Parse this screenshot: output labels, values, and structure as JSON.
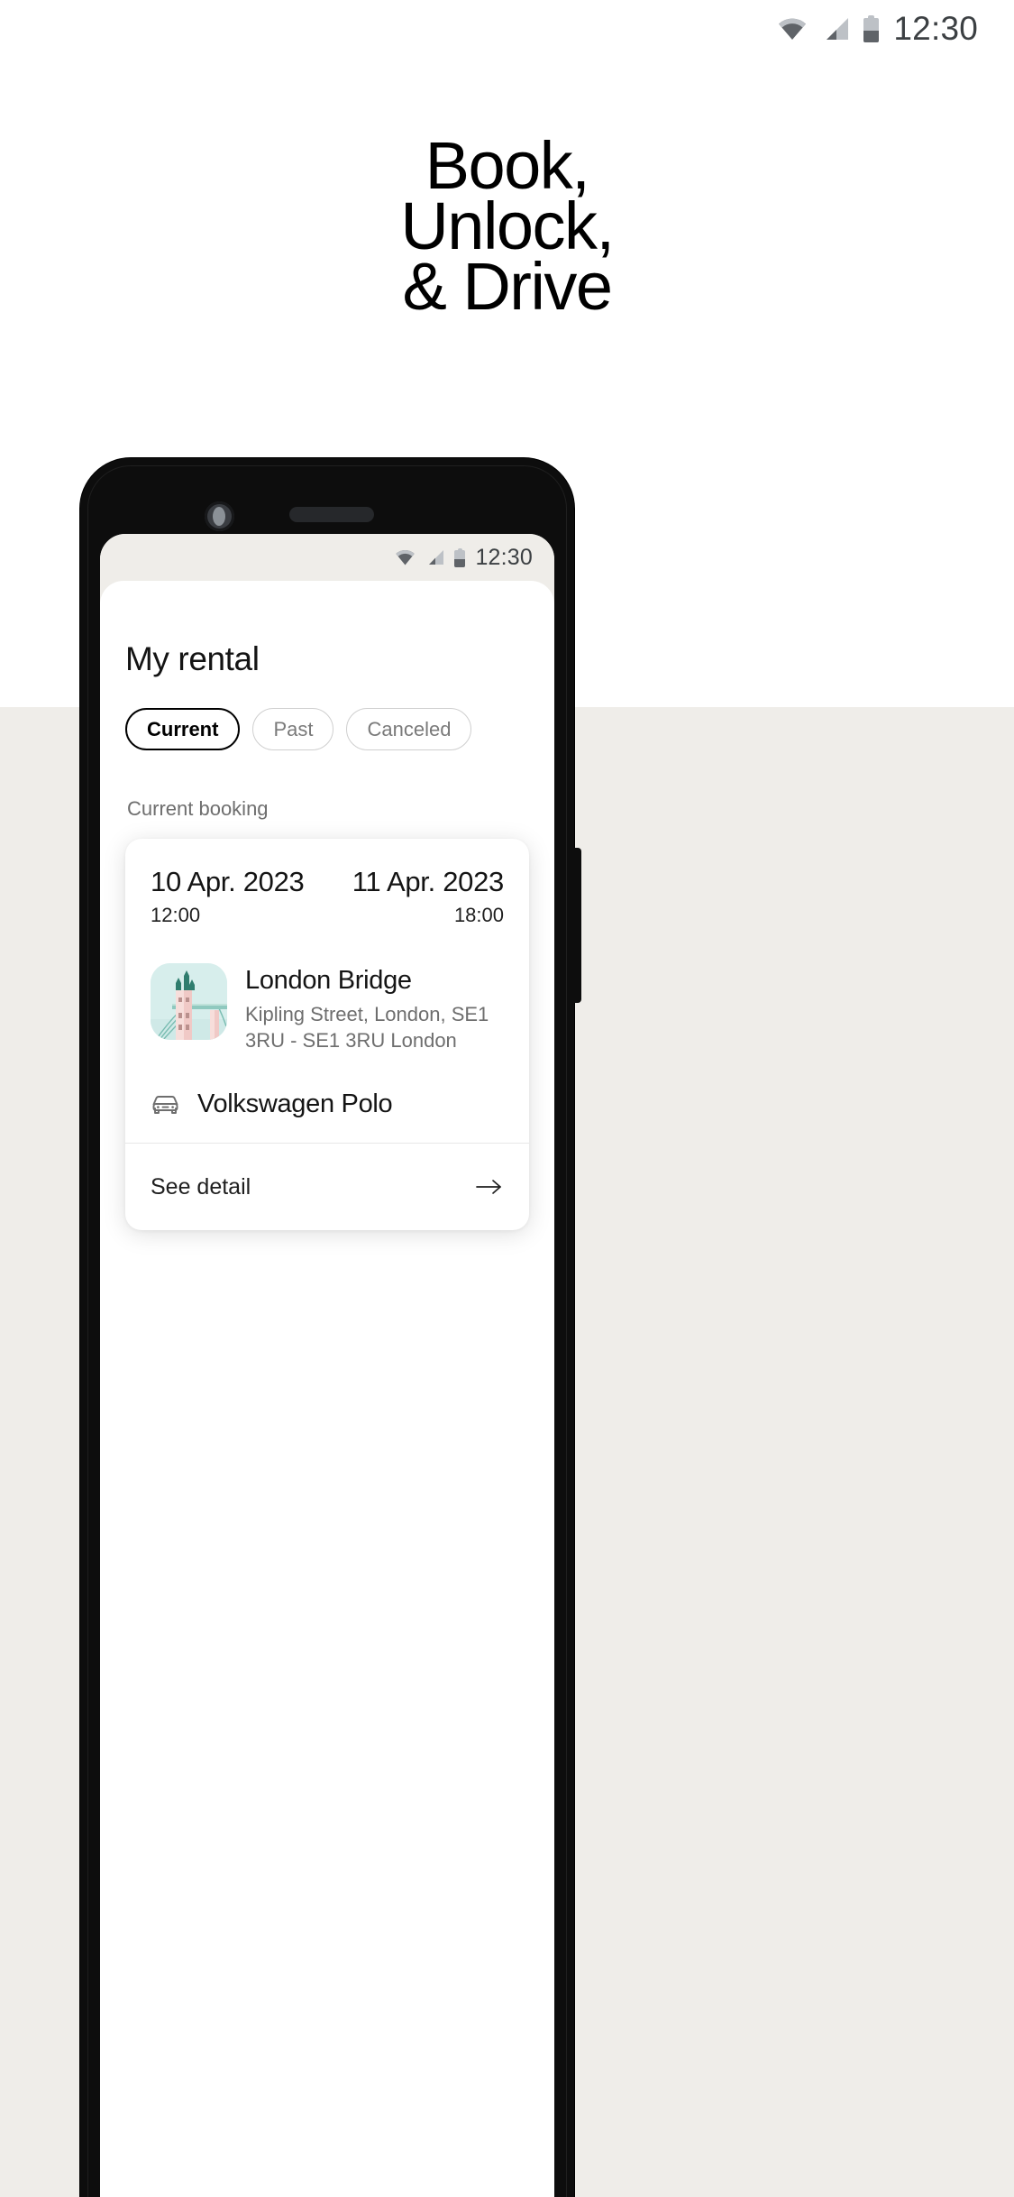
{
  "outer_status_bar": {
    "time": "12:30",
    "icons": [
      "wifi-icon",
      "cellular-signal-icon",
      "battery-icon"
    ]
  },
  "hero": {
    "lines": [
      "Book,",
      "Unlock,",
      "& Drive"
    ]
  },
  "phone": {
    "status_bar": {
      "time": "12:30",
      "icons": [
        "wifi-icon",
        "cellular-signal-icon",
        "battery-icon"
      ]
    },
    "app": {
      "page_title": "My rental",
      "filter_chips": [
        {
          "label": "Current",
          "state": "active"
        },
        {
          "label": "Past",
          "state": "inactive"
        },
        {
          "label": "Canceled",
          "state": "inactive"
        }
      ],
      "section_label": "Current booking",
      "booking_card": {
        "start": {
          "date": "10 Apr. 2023",
          "time": "12:00"
        },
        "end": {
          "date": "11 Apr. 2023",
          "time": "18:00"
        },
        "location": {
          "thumbnail": "tower-bridge-illustration",
          "name": "London Bridge",
          "address": "Kipling Street, London, SE1 3RU - SE1 3RU London"
        },
        "vehicle": {
          "icon": "car-icon",
          "name": "Volkswagen Polo"
        },
        "footer": {
          "label": "See detail",
          "icon": "arrow-right-icon"
        }
      }
    }
  },
  "colors": {
    "page_background": "#ffffff",
    "lower_backdrop": "#efede9",
    "device_frame": "#0d0d0d",
    "screen_status_bg": "#efede9",
    "app_background": "#ffffff",
    "text_primary": "#141414",
    "text_muted": "#6e6e6e",
    "chip_border_inactive": "#cfcfcf",
    "thumbnail_background": "#d7eeec"
  }
}
